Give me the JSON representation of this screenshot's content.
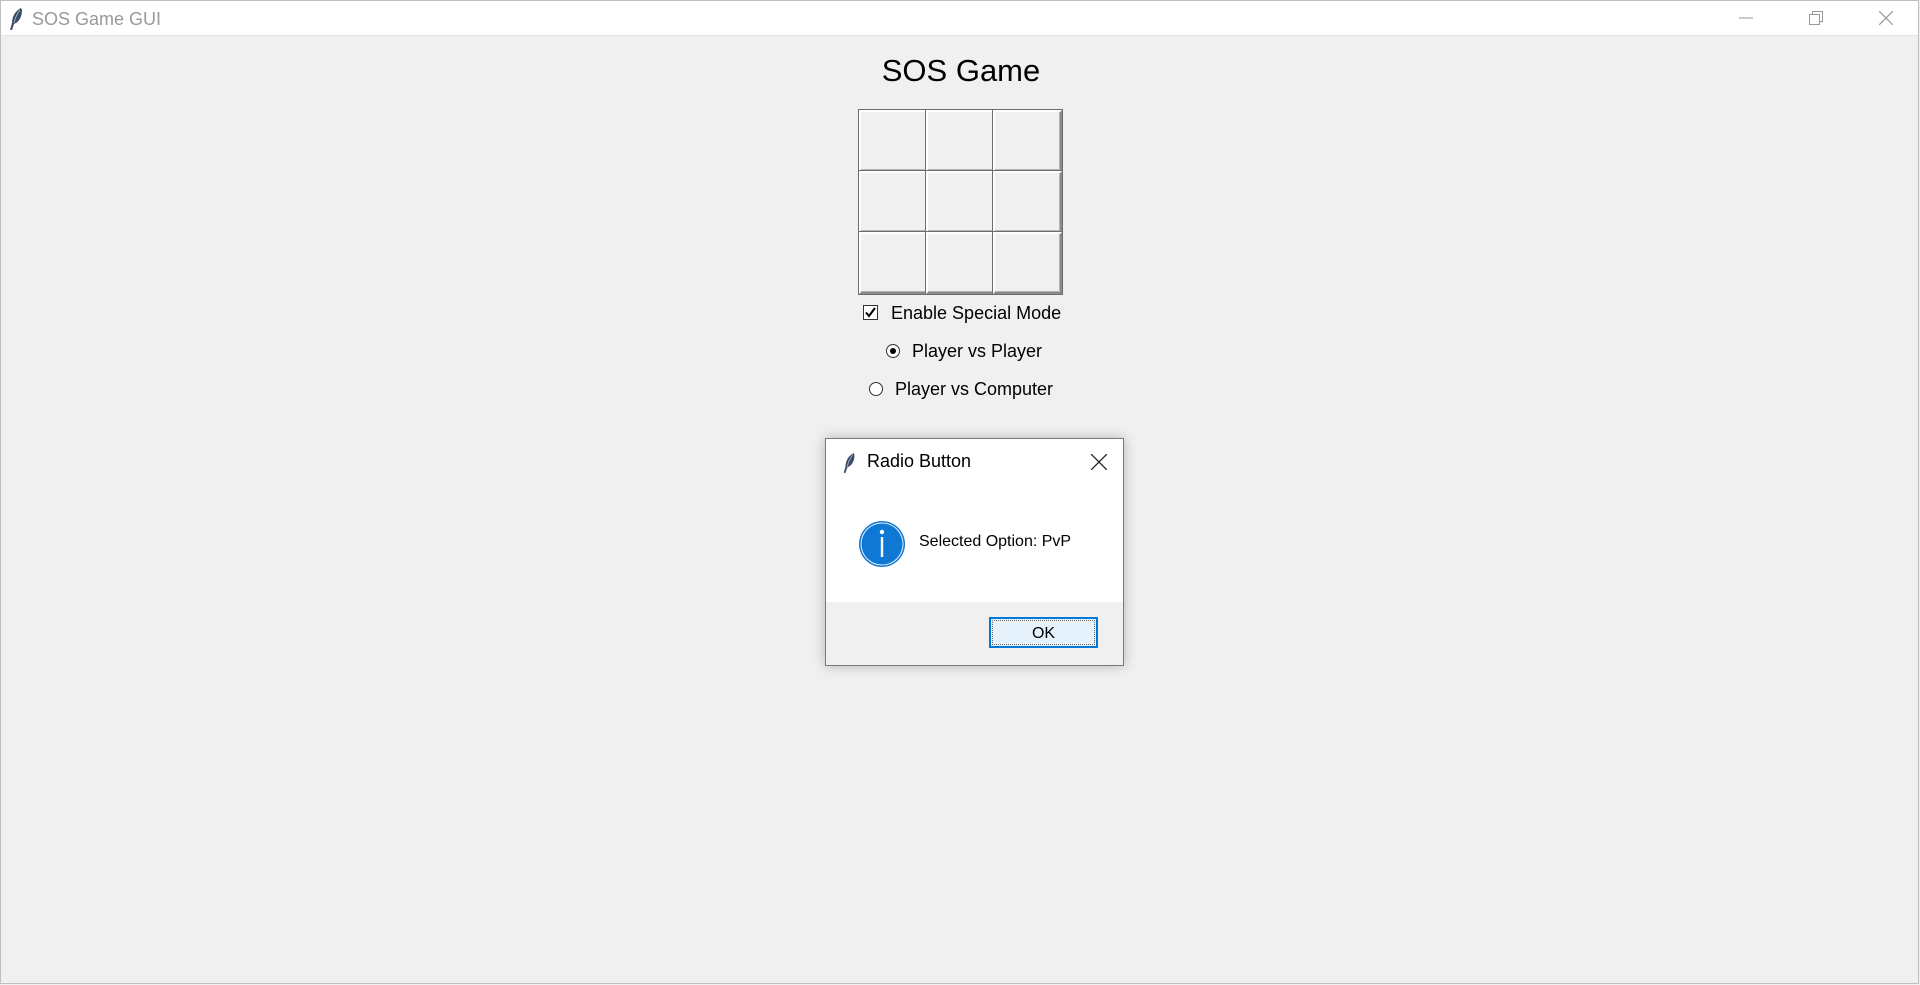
{
  "window": {
    "title": "SOS Game GUI"
  },
  "game": {
    "title": "SOS Game",
    "board": {
      "rows": 3,
      "cols": 3,
      "cells": [
        "",
        "",
        "",
        "",
        "",
        "",
        "",
        "",
        ""
      ]
    },
    "special_mode": {
      "label": "Enable Special Mode",
      "checked": true
    },
    "modes": [
      {
        "label": "Player vs Player",
        "selected": true
      },
      {
        "label": "Player vs Computer",
        "selected": false
      }
    ]
  },
  "dialog": {
    "title": "Radio Button",
    "icon": "info-icon",
    "message": "Selected Option: PvP",
    "ok_label": "OK"
  },
  "colors": {
    "window_bg": "#f0f0f0",
    "info_icon_blue": "#0f78d4",
    "focus_border": "#0078d7"
  }
}
